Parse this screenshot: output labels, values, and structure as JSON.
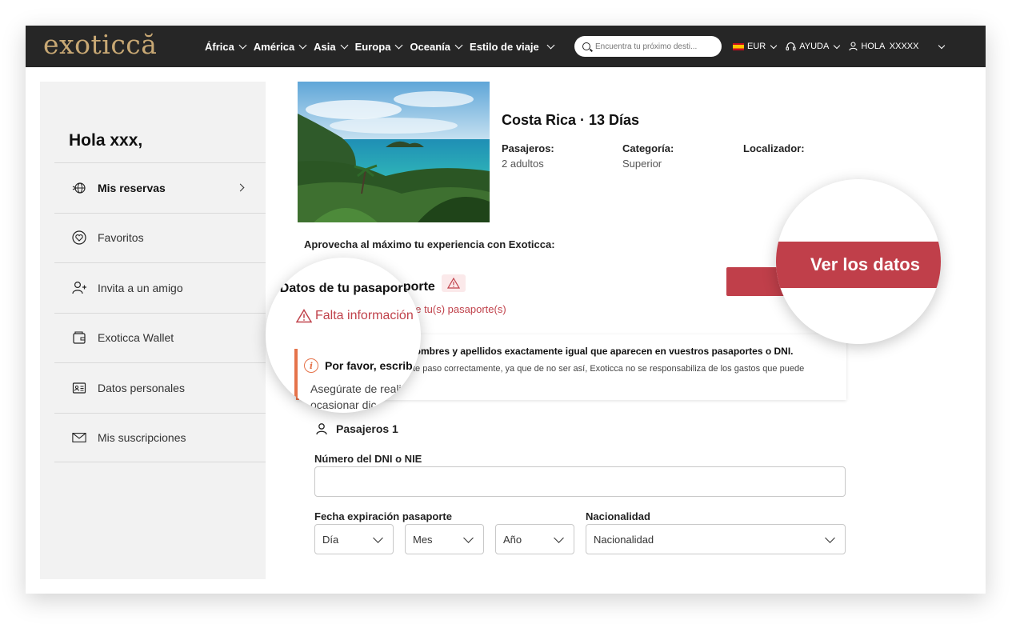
{
  "header": {
    "logo": "exoticcă",
    "nav": [
      {
        "label": "África"
      },
      {
        "label": "América"
      },
      {
        "label": "Asia"
      },
      {
        "label": "Europa"
      },
      {
        "label": "Oceanía"
      },
      {
        "label": "Estilo de viaje"
      }
    ],
    "search_placeholder": "Encuentra tu próximo desti...",
    "currency": "EUR",
    "help": "AYUDA",
    "user": "HOLA  XXXXX"
  },
  "sidebar": {
    "greeting": "Hola xxx,",
    "items": [
      {
        "label": "Mis reservas",
        "icon": "globe-plane-icon"
      },
      {
        "label": "Favoritos",
        "icon": "heart-circle-icon"
      },
      {
        "label": "Invita a un amigo",
        "icon": "add-user-icon"
      },
      {
        "label": "Exoticca Wallet",
        "icon": "wallet-icon"
      },
      {
        "label": "Datos personales",
        "icon": "id-card-icon"
      },
      {
        "label": "Mis suscripciones",
        "icon": "envelope-icon"
      }
    ]
  },
  "trip": {
    "title": "Costa Rica · 13 Días",
    "passengers_label": "Pasajeros:",
    "passengers_value": "2 adultos",
    "category_label": "Categoría:",
    "category_value": "Superior",
    "locator_label": "Localizador:"
  },
  "main": {
    "promo": "Aprovecha al máximo tu experiencia con Exoticca:",
    "section_title": "1. Datos de tu pasaporte",
    "missing_partial": "de tu(s) pasaporte(s)",
    "view_button": "Ver los datos",
    "view_button_partial": "Ve",
    "notice_title_partial": "os nombres y apellidos exactamente igual que aparecen en vuestros pasaportes o DNI.",
    "notice_desc_partial": "te paso correctamente, ya que de no ser así, Exoticca no se responsabiliza de los gastos que puede",
    "pax_title": "Pasajeros 1",
    "dni_label": "Número del DNI o NIE",
    "expiry_label": "Fecha expiración pasaporte",
    "nationality_label": "Nacionalidad",
    "day": "Día",
    "month": "Mes",
    "year": "Año",
    "nationality": "Nacionalidad"
  },
  "magnifier_left": {
    "title": "1. Datos de tu pasaporte",
    "missing": "Falta información",
    "notice_title": "Por favor, escrib",
    "notice_line1": "Asegúrate de reali",
    "notice_line2": "ocasionar dic"
  },
  "magnifier_right": {
    "button": "Ver los datos"
  },
  "colors": {
    "header_bg": "#262626",
    "logo_gold": "#c8a874",
    "primary_red": "#c03f4a",
    "warning_orange": "#e5734a",
    "sidebar_bg": "#f2f2f2"
  }
}
